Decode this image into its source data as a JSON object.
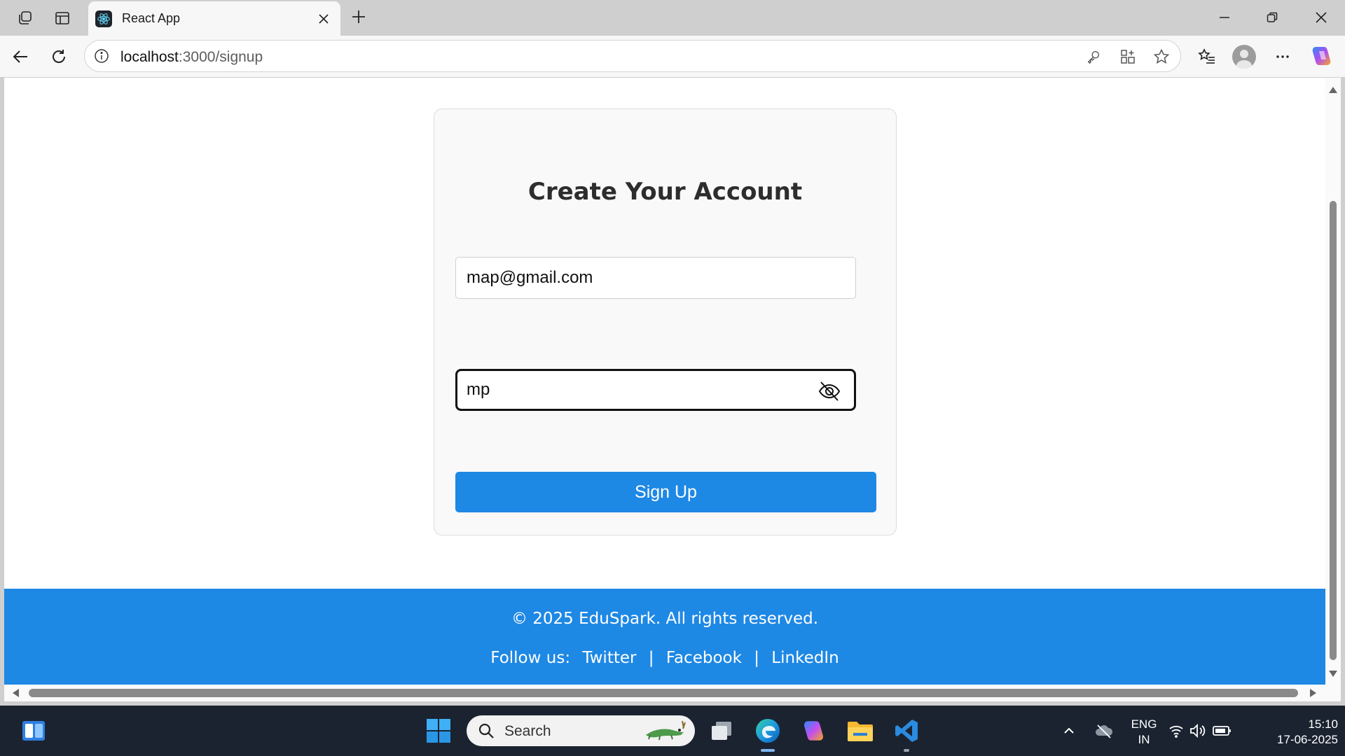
{
  "browser": {
    "tab_title": "React App",
    "url_host": "localhost",
    "url_path": ":3000/signup"
  },
  "page": {
    "title": "Create Your Account",
    "email_value": "map@gmail.com",
    "password_value": "mp",
    "signup_label": "Sign Up",
    "footer_copyright": "© 2025 EduSpark. All rights reserved.",
    "footer_follow_label": "Follow us:",
    "footer_links": [
      "Twitter",
      "Facebook",
      "LinkedIn"
    ],
    "footer_separator": "|",
    "accent_color": "#1e88e5"
  },
  "taskbar": {
    "search_placeholder": "Search",
    "language": "ENG",
    "region": "IN",
    "time": "15:10",
    "date": "17-06-2025"
  }
}
